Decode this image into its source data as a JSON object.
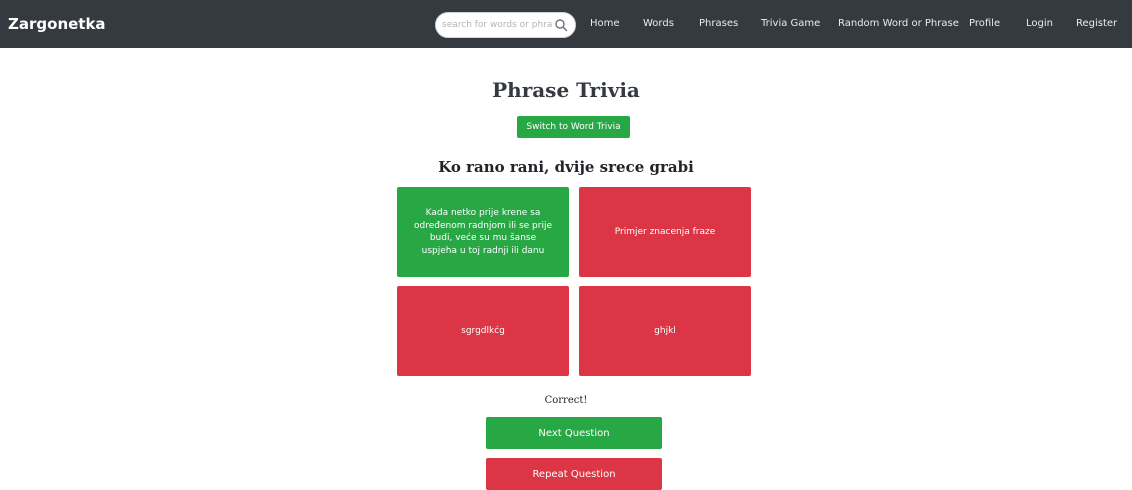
{
  "navbar": {
    "brand": "Zargonetka",
    "search_placeholder": "search for words or phrases",
    "links": [
      "Home",
      "Words",
      "Phrases",
      "Trivia Game",
      "Random Word or Phrase",
      "Profile",
      "Login",
      "Register"
    ]
  },
  "main": {
    "title": "Phrase Trivia",
    "switch_label": "Switch to Word Trivia",
    "question": "Ko rano rani, dvije srece grabi",
    "answers": [
      {
        "text": "Kada netko prije krene sa određenom radnjom ili se prije budi, veće su mu šanse uspjeha u toj radnji ili danu",
        "status": "correct"
      },
      {
        "text": "Primjer znacenja fraze",
        "status": "incorrect"
      },
      {
        "text": "sgrgdlkćg",
        "status": "incorrect"
      },
      {
        "text": "ghjkl",
        "status": "incorrect"
      }
    ],
    "result_text": "Correct!",
    "next_label": "Next Question",
    "repeat_label": "Repeat Question"
  },
  "colors": {
    "navbar": "#343a40",
    "correct": "#28a745",
    "incorrect": "#dc3545"
  }
}
